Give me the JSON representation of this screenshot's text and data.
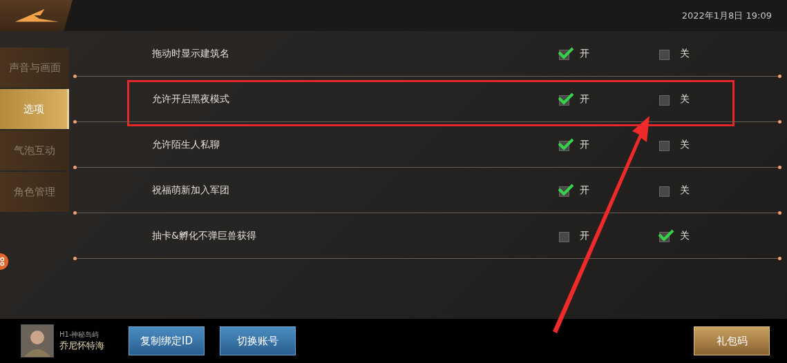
{
  "top_bar": {
    "datetime": "2022年1月8日  19:09"
  },
  "sidebar": {
    "items": [
      {
        "label": "声音与画面",
        "selected": false
      },
      {
        "label": "选项",
        "selected": true
      },
      {
        "label": "气泡互动",
        "selected": false
      },
      {
        "label": "角色管理",
        "selected": false
      }
    ]
  },
  "options": [
    {
      "label": "拖动时显示建筑名",
      "on_label": "开",
      "off_label": "关",
      "on": true,
      "highlighted": false
    },
    {
      "label": "允许开启黑夜模式",
      "on_label": "开",
      "off_label": "关",
      "on": true,
      "highlighted": true
    },
    {
      "label": "允许陌生人私聊",
      "on_label": "开",
      "off_label": "关",
      "on": true,
      "highlighted": false
    },
    {
      "label": "祝福萌新加入军团",
      "on_label": "开",
      "off_label": "关",
      "on": true,
      "highlighted": false
    },
    {
      "label": "抽卡&孵化不弹巨兽获得",
      "on_label": "开",
      "off_label": "关",
      "on": false,
      "highlighted": false
    }
  ],
  "footer": {
    "player": {
      "server": "H1-神秘岛屿",
      "name": "乔尼怀特海"
    },
    "buttons": [
      {
        "label": "复制绑定ID",
        "kind": "blue"
      },
      {
        "label": "切换账号",
        "kind": "blue"
      },
      {
        "label": "礼包码",
        "kind": "gold"
      }
    ]
  }
}
